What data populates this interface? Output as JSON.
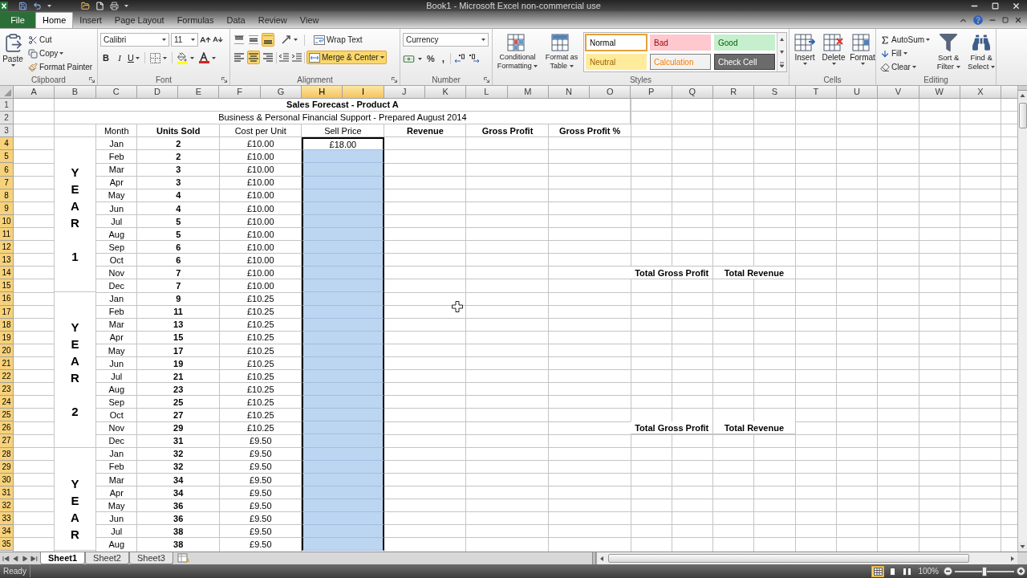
{
  "title_bar": {
    "title": "Book1 - Microsoft Excel non-commercial use"
  },
  "ribbon_tabs": [
    {
      "label": "File",
      "kind": "file",
      "selected": false
    },
    {
      "label": "Home",
      "kind": "tab",
      "selected": true
    },
    {
      "label": "Insert",
      "kind": "tab",
      "selected": false
    },
    {
      "label": "Page Layout",
      "kind": "tab",
      "selected": false
    },
    {
      "label": "Formulas",
      "kind": "tab",
      "selected": false
    },
    {
      "label": "Data",
      "kind": "tab",
      "selected": false
    },
    {
      "label": "Review",
      "kind": "tab",
      "selected": false
    },
    {
      "label": "View",
      "kind": "tab",
      "selected": false
    }
  ],
  "ribbon": {
    "clipboard": {
      "group_label": "Clipboard",
      "paste": "Paste",
      "cut": "Cut",
      "copy": "Copy",
      "format_painter": "Format Painter"
    },
    "font": {
      "group_label": "Font",
      "font_name": "Calibri",
      "font_size": "11",
      "bold": "B",
      "italic": "I",
      "underline": "U"
    },
    "alignment": {
      "group_label": "Alignment",
      "vertical": [
        {
          "kind": "top",
          "selected": false
        },
        {
          "kind": "middle",
          "selected": false
        },
        {
          "kind": "bottom",
          "selected": true
        }
      ],
      "horizontal": [
        {
          "kind": "left",
          "selected": false
        },
        {
          "kind": "center",
          "selected": true
        },
        {
          "kind": "right",
          "selected": false
        }
      ],
      "wrap_text": {
        "label": "Wrap Text",
        "selected": false
      },
      "merge_center": {
        "label": "Merge & Center",
        "selected": true
      }
    },
    "number": {
      "group_label": "Number",
      "format": "Currency",
      "percent": "%",
      "comma": ","
    },
    "styles": {
      "group_label": "Styles",
      "conditional_formatting": "Conditional Formatting",
      "format_as_table": "Format as Table",
      "gallery": [
        {
          "name": "Normal",
          "kind": "normal",
          "selected": true
        },
        {
          "name": "Bad",
          "kind": "bad",
          "selected": false
        },
        {
          "name": "Good",
          "kind": "good",
          "selected": false
        },
        {
          "name": "Neutral",
          "kind": "neutral",
          "selected": false
        },
        {
          "name": "Calculation",
          "kind": "calculation",
          "selected": false
        },
        {
          "name": "Check Cell",
          "kind": "check",
          "selected": false
        }
      ]
    },
    "cells": {
      "group_label": "Cells",
      "insert": "Insert",
      "delete": "Delete",
      "format": "Format"
    },
    "editing": {
      "group_label": "Editing",
      "autosum": "AutoSum",
      "fill": "Fill",
      "clear": "Clear",
      "sort_filter": "Sort & Filter",
      "find_select": "Find & Select"
    }
  },
  "columns": [
    {
      "label": "A",
      "selected": false
    },
    {
      "label": "B",
      "selected": false
    },
    {
      "label": "C",
      "selected": false
    },
    {
      "label": "D",
      "selected": false
    },
    {
      "label": "E",
      "selected": false
    },
    {
      "label": "F",
      "selected": false
    },
    {
      "label": "G",
      "selected": false
    },
    {
      "label": "H",
      "selected": true
    },
    {
      "label": "I",
      "selected": true
    },
    {
      "label": "J",
      "selected": false
    },
    {
      "label": "K",
      "selected": false
    },
    {
      "label": "L",
      "selected": false
    },
    {
      "label": "M",
      "selected": false
    },
    {
      "label": "N",
      "selected": false
    },
    {
      "label": "O",
      "selected": false
    },
    {
      "label": "P",
      "selected": false
    },
    {
      "label": "Q",
      "selected": false
    },
    {
      "label": "R",
      "selected": false
    },
    {
      "label": "S",
      "selected": false
    },
    {
      "label": "T",
      "selected": false
    },
    {
      "label": "U",
      "selected": false
    },
    {
      "label": "V",
      "selected": false
    },
    {
      "label": "W",
      "selected": false
    },
    {
      "label": "X",
      "selected": false
    }
  ],
  "rows": [
    {
      "label": "1",
      "selected": false
    },
    {
      "label": "2",
      "selected": false
    },
    {
      "label": "3",
      "selected": false
    },
    {
      "label": "4",
      "selected": true
    },
    {
      "label": "5",
      "selected": true
    },
    {
      "label": "6",
      "selected": true
    },
    {
      "label": "7",
      "selected": true
    },
    {
      "label": "8",
      "selected": true
    },
    {
      "label": "9",
      "selected": true
    },
    {
      "label": "10",
      "selected": true
    },
    {
      "label": "11",
      "selected": true
    },
    {
      "label": "12",
      "selected": true
    },
    {
      "label": "13",
      "selected": true
    },
    {
      "label": "14",
      "selected": true
    },
    {
      "label": "15",
      "selected": true
    },
    {
      "label": "16",
      "selected": true
    },
    {
      "label": "17",
      "selected": true
    },
    {
      "label": "18",
      "selected": true
    },
    {
      "label": "19",
      "selected": true
    },
    {
      "label": "20",
      "selected": true
    },
    {
      "label": "21",
      "selected": true
    },
    {
      "label": "22",
      "selected": true
    },
    {
      "label": "23",
      "selected": true
    },
    {
      "label": "24",
      "selected": true
    },
    {
      "label": "25",
      "selected": true
    },
    {
      "label": "26",
      "selected": true
    },
    {
      "label": "27",
      "selected": true
    },
    {
      "label": "28",
      "selected": true
    },
    {
      "label": "29",
      "selected": true
    },
    {
      "label": "30",
      "selected": true
    },
    {
      "label": "31",
      "selected": true
    },
    {
      "label": "32",
      "selected": true
    },
    {
      "label": "33",
      "selected": true
    },
    {
      "label": "34",
      "selected": true
    },
    {
      "label": "35",
      "selected": true
    }
  ],
  "sheet": {
    "title": "Sales Forecast - Product A",
    "subtitle": "Business & Personal Financial Support - Prepared August 2014",
    "headers": [
      {
        "text": "Month",
        "bold": false
      },
      {
        "text": "Units Sold",
        "bold": true
      },
      {
        "text": "Cost per Unit",
        "bold": false
      },
      {
        "text": "Sell Price",
        "bold": false
      },
      {
        "text": "Revenue",
        "bold": true
      },
      {
        "text": "Gross Profit",
        "bold": true
      },
      {
        "text": "Gross Profit %",
        "bold": true
      }
    ],
    "years": [
      {
        "label": "YEAR",
        "number": "1",
        "months": [
          {
            "month": "Jan",
            "units": "2",
            "cost": "£10.00",
            "sell_price": "£18.00",
            "selected": true,
            "active": true
          },
          {
            "month": "Feb",
            "units": "2",
            "cost": "£10.00",
            "selected": true,
            "active": false
          },
          {
            "month": "Mar",
            "units": "3",
            "cost": "£10.00",
            "selected": true,
            "active": false
          },
          {
            "month": "Apr",
            "units": "3",
            "cost": "£10.00",
            "selected": true,
            "active": false
          },
          {
            "month": "May",
            "units": "4",
            "cost": "£10.00",
            "selected": true,
            "active": false
          },
          {
            "month": "Jun",
            "units": "4",
            "cost": "£10.00",
            "selected": true,
            "active": false
          },
          {
            "month": "Jul",
            "units": "5",
            "cost": "£10.00",
            "selected": true,
            "active": false
          },
          {
            "month": "Aug",
            "units": "5",
            "cost": "£10.00",
            "selected": true,
            "active": false
          },
          {
            "month": "Sep",
            "units": "6",
            "cost": "£10.00",
            "selected": true,
            "active": false
          },
          {
            "month": "Oct",
            "units": "6",
            "cost": "£10.00",
            "selected": true,
            "active": false
          },
          {
            "month": "Nov",
            "units": "7",
            "cost": "£10.00",
            "selected": true,
            "active": false,
            "totals": [
              "Total Gross Profit",
              "Total Revenue"
            ]
          },
          {
            "month": "Dec",
            "units": "7",
            "cost": "£10.00",
            "selected": true,
            "active": false
          }
        ]
      },
      {
        "label": "YEAR",
        "number": "2",
        "months": [
          {
            "month": "Jan",
            "units": "9",
            "cost": "£10.25",
            "selected": true,
            "active": false
          },
          {
            "month": "Feb",
            "units": "11",
            "cost": "£10.25",
            "selected": true,
            "active": false
          },
          {
            "month": "Mar",
            "units": "13",
            "cost": "£10.25",
            "selected": true,
            "active": false
          },
          {
            "month": "Apr",
            "units": "15",
            "cost": "£10.25",
            "selected": true,
            "active": false
          },
          {
            "month": "May",
            "units": "17",
            "cost": "£10.25",
            "selected": true,
            "active": false
          },
          {
            "month": "Jun",
            "units": "19",
            "cost": "£10.25",
            "selected": true,
            "active": false
          },
          {
            "month": "Jul",
            "units": "21",
            "cost": "£10.25",
            "selected": true,
            "active": false
          },
          {
            "month": "Aug",
            "units": "23",
            "cost": "£10.25",
            "selected": true,
            "active": false
          },
          {
            "month": "Sep",
            "units": "25",
            "cost": "£10.25",
            "selected": true,
            "active": false
          },
          {
            "month": "Oct",
            "units": "27",
            "cost": "£10.25",
            "selected": true,
            "active": false
          },
          {
            "month": "Nov",
            "units": "29",
            "cost": "£10.25",
            "selected": true,
            "active": false,
            "totals": [
              "Total Gross Profit",
              "Total Revenue"
            ]
          },
          {
            "month": "Dec",
            "units": "31",
            "cost": "£9.50",
            "selected": true,
            "active": false
          }
        ]
      },
      {
        "label": "YEAR",
        "months": [
          {
            "month": "Jan",
            "units": "32",
            "cost": "£9.50",
            "selected": true,
            "active": false
          },
          {
            "month": "Feb",
            "units": "32",
            "cost": "£9.50",
            "selected": true,
            "active": false
          },
          {
            "month": "Mar",
            "units": "34",
            "cost": "£9.50",
            "selected": true,
            "active": false
          },
          {
            "month": "Apr",
            "units": "34",
            "cost": "£9.50",
            "selected": true,
            "active": false
          },
          {
            "month": "May",
            "units": "36",
            "cost": "£9.50",
            "selected": true,
            "active": false
          },
          {
            "month": "Jun",
            "units": "36",
            "cost": "£9.50",
            "selected": true,
            "active": false
          },
          {
            "month": "Jul",
            "units": "38",
            "cost": "£9.50",
            "selected": true,
            "active": false
          },
          {
            "month": "Aug",
            "units": "38",
            "cost": "£9.50",
            "selected": true,
            "active": false
          }
        ]
      }
    ]
  },
  "sheet_tabs": [
    {
      "label": "Sheet1",
      "selected": true
    },
    {
      "label": "Sheet2",
      "selected": false
    },
    {
      "label": "Sheet3",
      "selected": false
    }
  ],
  "status_bar": {
    "status": "Ready",
    "views": [
      {
        "kind": "normal",
        "selected": true
      },
      {
        "kind": "page_layout",
        "selected": false
      },
      {
        "kind": "page_break",
        "selected": false
      }
    ],
    "zoom": "100%",
    "zoom_slider": {
      "level": 0.5
    }
  }
}
